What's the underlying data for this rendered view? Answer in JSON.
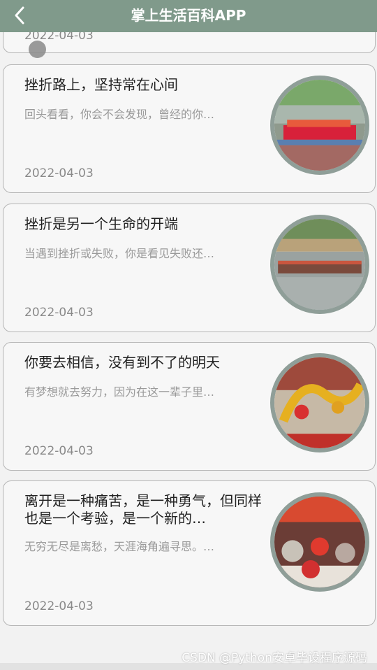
{
  "header": {
    "title": "掌上生活百科APP"
  },
  "articles": [
    {
      "title": "",
      "summary": "",
      "date": "2022-04-03"
    },
    {
      "title": "挫折路上，坚持常在心间",
      "summary": "回头看看，你会不会发现，曾经的你…",
      "date": "2022-04-03"
    },
    {
      "title": "挫折是另一个生命的开端",
      "summary": "当遇到挫折或失败，你是看见失败还…",
      "date": "2022-04-03"
    },
    {
      "title": "你要去相信，没有到不了的明天",
      "summary": "有梦想就去努力，因为在这一辈子里…",
      "date": "2022-04-03"
    },
    {
      "title": "离开是一种痛苦，是一种勇气，但同样也是一个考验，是一个新的…",
      "summary": "无穷无尽是离愁，天涯海角遍寻思。…",
      "date": "2022-04-03"
    }
  ],
  "watermark": "CSDN @Python安卓毕设程序源码",
  "colors": {
    "header": "#809a8b",
    "thumb_border": "#8f9e98"
  }
}
